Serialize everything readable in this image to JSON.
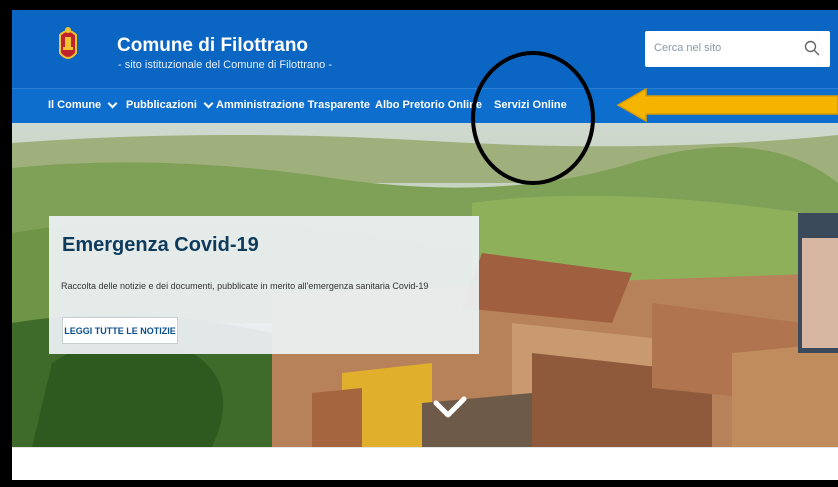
{
  "header": {
    "title": "Comune di Filottrano",
    "subtitle": "- sito istituzionale del Comune di Filottrano -",
    "brand_color": "#0a66c2"
  },
  "search": {
    "placeholder": "Cerca nel sito",
    "icon": "search-icon"
  },
  "nav": {
    "items": [
      {
        "label": "Il Comune",
        "dropdown": true
      },
      {
        "label": "Pubblicazioni",
        "dropdown": true
      },
      {
        "label": "Amministrazione Trasparente",
        "dropdown": false
      },
      {
        "label": "Albo Pretorio Online",
        "dropdown": false
      },
      {
        "label": "Servizi Online",
        "dropdown": false
      }
    ]
  },
  "hero": {
    "title": "Emergenza Covid-19",
    "text": "Raccolta delle notizie e dei documenti, pubblicate in merito all'emergenza sanitaria Covid-19",
    "button": "LEGGI TUTTE LE NOTIZIE",
    "scroll_icon": "chevron-down-icon"
  },
  "annotations": {
    "circle_target": "Servizi Online",
    "arrow_color": "#f5b400",
    "circle_color": "#000000"
  }
}
